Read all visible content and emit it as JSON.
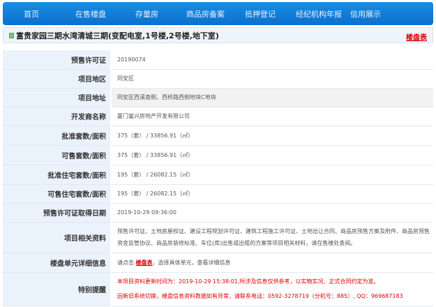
{
  "nav": [
    "首页",
    "在售楼盘",
    "存量房",
    "商品房备案",
    "抵押登记",
    "经纪机构年报",
    "信用展示"
  ],
  "title": "富贵家园三期水湾清城三期(变配电室,1号楼,2号楼,地下室)",
  "title_link": "楼盘表",
  "rows": [
    {
      "label": "预售许可证",
      "value": "20190074"
    },
    {
      "label": "项目地区",
      "value": "同安区"
    },
    {
      "label": "项目地址",
      "value": "同安区西溪南侧、西桥路西侧地块C地块"
    },
    {
      "label": "开发商名称",
      "value": "厦门富兴房地产开发有限公司"
    },
    {
      "label": "批准套数/面积",
      "value": "375（套） / 33856.91（㎡）"
    },
    {
      "label": "可售套数/面积",
      "value": "375（套） / 33856.91（㎡）"
    },
    {
      "label": "批准住宅套数/面积",
      "value": "195（套） / 26082.15（㎡）"
    },
    {
      "label": "可售住宅套数/面积",
      "value": "195（套） / 26082.15（㎡）"
    },
    {
      "label": "预售许可证取得日期",
      "value": "2019-10-29 09:36:00"
    },
    {
      "label": "项目相关资料",
      "value": "预售许可证、土地房屋权证、建设工程规划许可证、建筑工程施工许可证、土地出让合同、商品房预售方案及附件、商品房预售资金监管协议、商品房装修标准、车位(库)出售或出租的方案等项目相关材料，请在售楼处查阅。"
    },
    {
      "label": "楼盘单元详细信息",
      "pre": "请点击 ",
      "link": "楼盘表",
      "post": "，选择具体单元，查看详细信息"
    },
    {
      "label": "特别提醒",
      "line1": "本项目资料更新时间为：2019-10-29 15:38:01,所涉及信息仅供参考，以实物实况、正式合同约定为准。",
      "line2": "因新旧系统切换，楼盘信息资料数据如有异常，请联系电话：0592-3278719（分机号：885）, QQ：969687183"
    }
  ]
}
